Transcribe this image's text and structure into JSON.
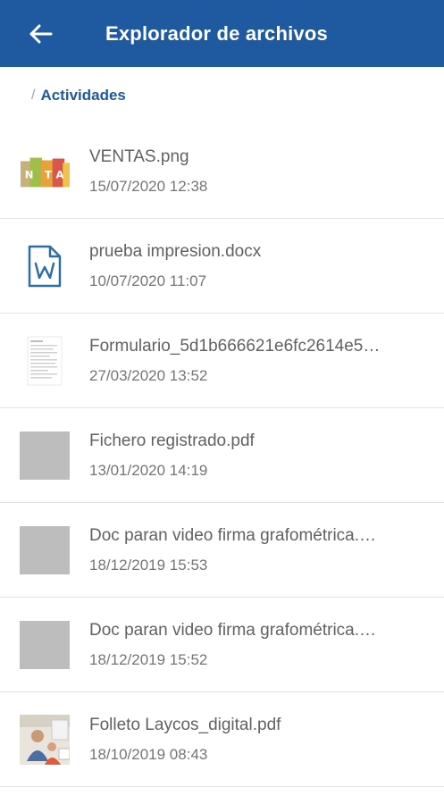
{
  "header": {
    "title": "Explorador de archivos",
    "back_icon": "arrow-left-icon",
    "background": "#1f5aa0"
  },
  "breadcrumb": {
    "separator": "/",
    "current": "Actividades"
  },
  "files": [
    {
      "name": "VENTAS.png",
      "date": "15/07/2020 12:38",
      "thumbnail": "image-thumbnail"
    },
    {
      "name": "prueba impresion.docx",
      "date": "10/07/2020 11:07",
      "thumbnail": "word-doc-icon"
    },
    {
      "name": "Formulario_5d1b666621e6fc2614e5…",
      "date": "27/03/2020 13:52",
      "thumbnail": "form-thumbnail"
    },
    {
      "name": "Fichero registrado.pdf",
      "date": "13/01/2020 14:19",
      "thumbnail": "placeholder"
    },
    {
      "name": "Doc paran video firma grafométrica.…",
      "date": "18/12/2019 15:53",
      "thumbnail": "placeholder"
    },
    {
      "name": "Doc paran video firma grafométrica.…",
      "date": "18/12/2019 15:52",
      "thumbnail": "placeholder"
    },
    {
      "name": "Folleto Laycos_digital.pdf",
      "date": "18/10/2019 08:43",
      "thumbnail": "photo-thumbnail"
    }
  ]
}
